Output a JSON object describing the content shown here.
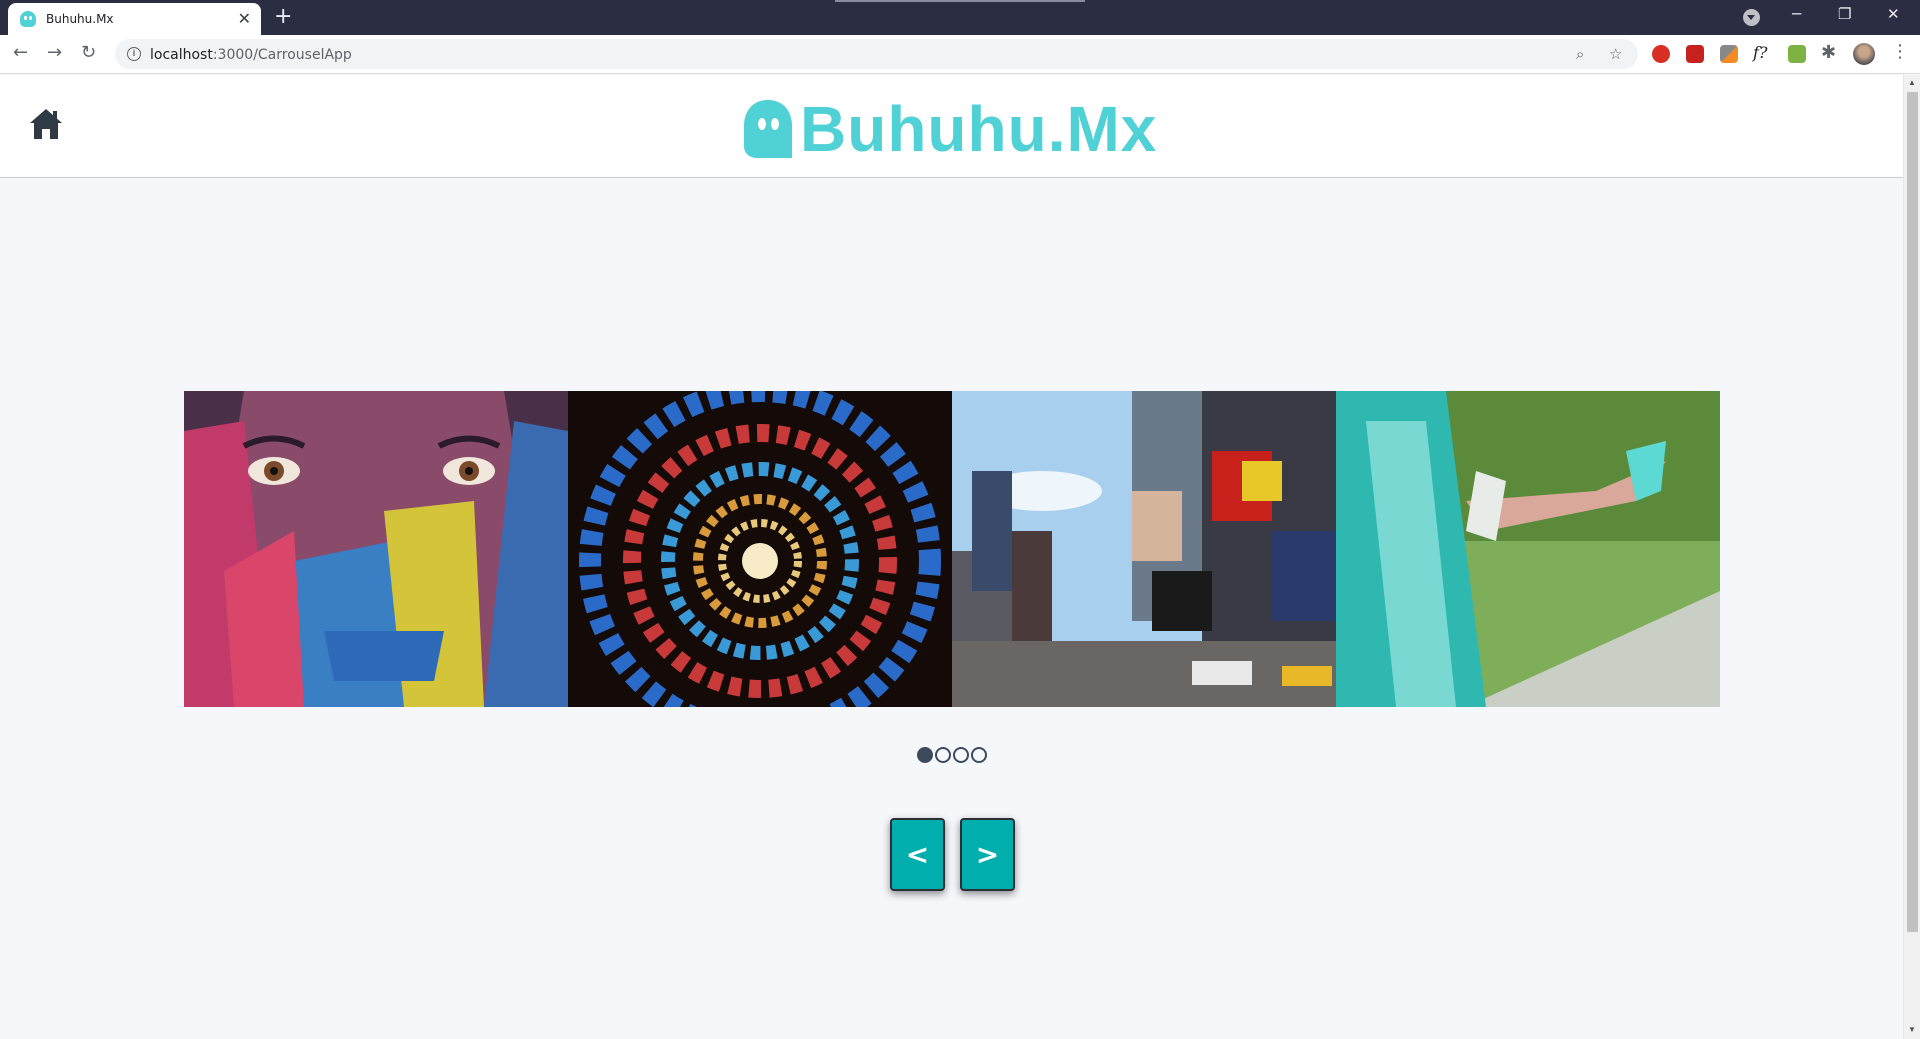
{
  "browser": {
    "tab_title": "Buhuhu.Mx",
    "tab_close": "✕",
    "new_tab": "+",
    "url_host": "localhost",
    "url_path": ":3000/CarrouselApp",
    "window_minimize": "─",
    "window_restore": "❐",
    "window_close": "✕"
  },
  "header": {
    "logo_text": "Buhuhu.Mx",
    "brand_color": "#4fd1d6"
  },
  "carousel": {
    "slides": [
      {
        "name": "colorful-painted-face"
      },
      {
        "name": "stained-glass-spiral"
      },
      {
        "name": "times-square-street"
      },
      {
        "name": "legs-out-of-car-window"
      }
    ],
    "active_index": 0,
    "dot_count": 4
  },
  "controls": {
    "prev_label": "<",
    "next_label": ">",
    "button_color": "#00aeae"
  }
}
